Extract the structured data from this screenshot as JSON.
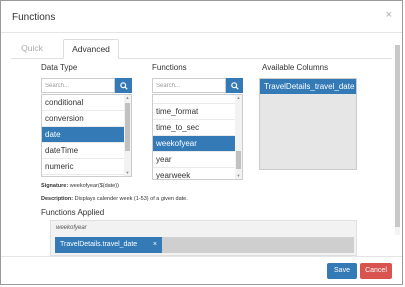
{
  "dialog": {
    "title": "Functions",
    "close_glyph": "×"
  },
  "tabs": [
    {
      "label": "Quick",
      "active": false
    },
    {
      "label": "Advanced",
      "active": true
    }
  ],
  "data_type": {
    "label": "Data Type",
    "search_placeholder": "Search...",
    "items": [
      {
        "label": "conditional",
        "selected": false
      },
      {
        "label": "conversion",
        "selected": false
      },
      {
        "label": "date",
        "selected": true
      },
      {
        "label": "dateTime",
        "selected": false
      },
      {
        "label": "numeric",
        "selected": false
      }
    ]
  },
  "functions": {
    "label": "Functions",
    "search_placeholder": "Search...",
    "items": [
      {
        "label": "time_format",
        "selected": false
      },
      {
        "label": "time_to_sec",
        "selected": false
      },
      {
        "label": "weekofyear",
        "selected": true
      },
      {
        "label": "year",
        "selected": false
      },
      {
        "label": "yearweek",
        "selected": false
      }
    ]
  },
  "available_columns": {
    "label": "Available Columns",
    "items": [
      {
        "label": "TravelDetails_travel_date",
        "selected": true
      }
    ]
  },
  "signature": {
    "label": "Signature:",
    "value": "weekofyear($(date))"
  },
  "description": {
    "label": "Description:",
    "value": "Displays calender week (1-53) of a given date."
  },
  "functions_applied": {
    "label": "Functions Applied",
    "function_name": "weekofyear",
    "chip_label": "TravelDetails.travel_date",
    "chip_remove": "×"
  },
  "buttons": {
    "save": "Save",
    "cancel": "Cancel"
  },
  "colors": {
    "primary": "#337ab7",
    "danger": "#d9534f"
  }
}
